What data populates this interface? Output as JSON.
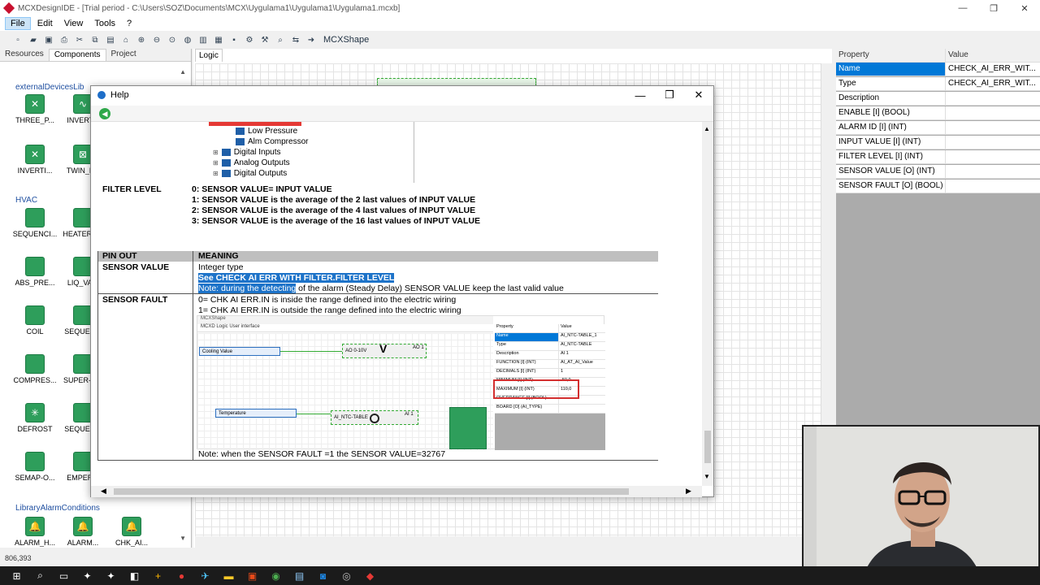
{
  "window": {
    "title": "MCXDesignIDE - [Trial period - C:\\Users\\SOZ\\Documents\\MCX\\Uygulama1\\Uygulama1\\Uygulama1.mcxb]",
    "minimize": "—",
    "restore": "❐",
    "close": "✕"
  },
  "menu": {
    "file": "File",
    "edit": "Edit",
    "view": "View",
    "tools": "Tools",
    "help": "?"
  },
  "toolbar": {
    "mcxshape": "MCXShape"
  },
  "leftpanel": {
    "tabs": [
      "Resources",
      "Components",
      "Project"
    ],
    "group1": "externalDevicesLib",
    "group2": "HVAC",
    "group3": "LibraryAlarmConditions",
    "items": [
      {
        "label": "THREE_P...",
        "icon": "✕"
      },
      {
        "label": "INVERT...",
        "icon": "∿"
      },
      {
        "label": "INVERTI...",
        "icon": "✕"
      },
      {
        "label": "TWIN_P...",
        "icon": "⊠"
      },
      {
        "label": "SEQUENCI...",
        "icon": ""
      },
      {
        "label": "HEATERS...",
        "icon": ""
      },
      {
        "label": "ABS_PRE...",
        "icon": ""
      },
      {
        "label": "LIQ_VA...",
        "icon": ""
      },
      {
        "label": "COIL",
        "icon": ""
      },
      {
        "label": "SEQUEN...",
        "icon": ""
      },
      {
        "label": "COMPRES...",
        "icon": ""
      },
      {
        "label": "SUPER-H...",
        "icon": ""
      },
      {
        "label": "DEFROST",
        "icon": "✳"
      },
      {
        "label": "SEQUEN...",
        "icon": ""
      },
      {
        "label": "SEMAP-O...",
        "icon": ""
      },
      {
        "label": "EMPER...",
        "icon": ""
      },
      {
        "label": "ALARM_H...",
        "icon": "🔔"
      },
      {
        "label": "ALARM...",
        "icon": "🔔"
      },
      {
        "label": "CHK_AI...",
        "icon": "🔔"
      }
    ]
  },
  "logic": {
    "tab": "Logic"
  },
  "properties": {
    "header_property": "Property",
    "header_value": "Value",
    "rows": [
      {
        "name": "Name",
        "value": "CHECK_AI_ERR_WIT..."
      },
      {
        "name": "Type",
        "value": "CHECK_AI_ERR_WIT..."
      },
      {
        "name": "Description",
        "value": ""
      },
      {
        "name": "ENABLE [I] (BOOL)",
        "value": ""
      },
      {
        "name": "ALARM ID [I] (INT)",
        "value": ""
      },
      {
        "name": "INPUT VALUE [I] (INT)",
        "value": ""
      },
      {
        "name": "FILTER LEVEL [I] (INT)",
        "value": ""
      },
      {
        "name": "SENSOR VALUE [O] (INT)",
        "value": ""
      },
      {
        "name": "SENSOR FAULT [O] (BOOL)",
        "value": ""
      }
    ]
  },
  "help": {
    "title": "Help",
    "tree": {
      "items": [
        "Low Pressure",
        "Alm Compressor",
        "Digital Inputs",
        "Analog Outputs",
        "Digital Outputs"
      ]
    },
    "filter_level": {
      "label": "FILTER LEVEL",
      "line0": "0: SENSOR VALUE= INPUT VALUE",
      "line1": "1: SENSOR VALUE is the average of the 2 last values of INPUT VALUE",
      "line2": "2: SENSOR VALUE is the average of the 4 last values of INPUT VALUE",
      "line3": "3: SENSOR VALUE is the average of the 16 last values of INPUT VALUE"
    },
    "pinout": {
      "col1": "PIN OUT",
      "col2": "MEANING",
      "sv_label": "SENSOR VALUE",
      "sv_line1": "Integer type",
      "sv_line2": "See CHECK AI ERR WITH FILTER.FILTER LEVEL",
      "sv_line3_hl": "Note: during the detecting",
      "sv_line3_rest": " of the alarm (Steady Delay) SENSOR VALUE keep the last valid value",
      "sf_label": "SENSOR FAULT",
      "sf_line1": "0= CHK AI ERR.IN is inside the range defined into the electric wiring",
      "sf_line2": "1= CHK AI ERR.IN is outside the range defined into the electric wiring",
      "note": "Note: when the SENSOR FAULT =1  the SENSOR VALUE=32767"
    },
    "embed": {
      "hdr": "MCXShape",
      "tabs": "MCXD   Logic    User interface",
      "block1": "Cooling Value",
      "block1b": "AO 0-10V",
      "block1c": "AO 1",
      "block2": "Temperature",
      "block2b": "AI_NTC-TABLE",
      "block2c": "AI 1",
      "props": [
        {
          "a": "Property",
          "b": "Value"
        },
        {
          "a": "Name",
          "b": "AI_NTC-TABLE_1"
        },
        {
          "a": "Type",
          "b": "AI_NTC-TABLE"
        },
        {
          "a": "Description",
          "b": "AI 1"
        },
        {
          "a": "FUNCTION [I] (INT)",
          "b": "AI_AT_AI_Value"
        },
        {
          "a": "DECIMALS [I] (INT)",
          "b": "1"
        },
        {
          "a": "MINIMUM [I] (INT)",
          "b": "-50,0"
        },
        {
          "a": "MAXIMUM [I] (INT)",
          "b": "110,0"
        },
        {
          "a": "OVERRANGE [I] (BOOL)",
          "b": ""
        },
        {
          "a": "BOARD [O] (AI_TYPE)",
          "b": ""
        }
      ]
    }
  },
  "status": {
    "coords": "806,393"
  },
  "colors": {
    "accent": "#0078d7",
    "green": "#2e9e5b",
    "highlight": "#1d73c9"
  }
}
